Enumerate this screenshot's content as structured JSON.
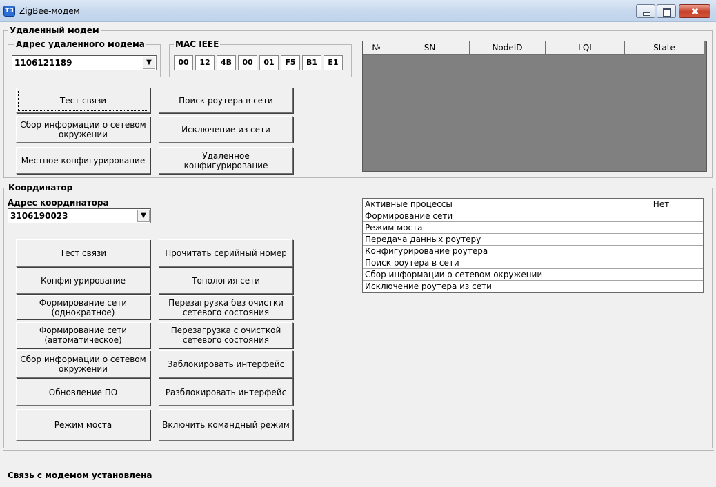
{
  "window": {
    "title": "ZigBee-модем",
    "icon": "tz-app-icon"
  },
  "remote": {
    "group_label": "Удаленный модем",
    "address_label": "Адрес удаленного модема",
    "address_value": "1106121189",
    "mac_label": "MAC IEEE",
    "mac_bytes": [
      "00",
      "12",
      "4B",
      "00",
      "01",
      "F5",
      "B1",
      "E1"
    ],
    "buttons": {
      "test": "Тест связи",
      "find_router": "Поиск роутера в сети",
      "collect_info": "Сбор информации о сетевом окружении",
      "exclude": "Исключение из сети",
      "local_config": "Местное конфигурирование",
      "remote_config": "Удаленное конфигурирование"
    },
    "grid_columns": [
      "№",
      "SN",
      "NodeID",
      "LQI",
      "State"
    ]
  },
  "coordinator": {
    "group_label": "Координатор",
    "address_label": "Адрес координатора",
    "address_value": "3106190023",
    "buttons": {
      "test": "Тест связи",
      "read_serial": "Прочитать серийный номер",
      "configure": "Конфигурирование",
      "topology": "Топология сети",
      "form_once": "Формирование сети (однократное)",
      "reboot_no_clear": "Перезагрузка без очистки сетевого состояния",
      "form_auto": "Формирование сети (автоматическое)",
      "reboot_clear": "Перезагрузка с очисткой сетевого состояния",
      "collect_info": "Сбор информации о сетевом окружении",
      "lock": "Заблокировать интерфейс",
      "update_fw": "Обновление ПО",
      "unlock": "Разблокировать интерфейс",
      "bridge": "Режим моста",
      "command_mode": "Включить командный режим"
    },
    "processes": [
      {
        "name": "Активные процессы",
        "value": "Нет"
      },
      {
        "name": "Формирование сети",
        "value": ""
      },
      {
        "name": "Режим моста",
        "value": ""
      },
      {
        "name": "Передача данных роутеру",
        "value": ""
      },
      {
        "name": "Конфигурирование роутера",
        "value": ""
      },
      {
        "name": "Поиск роутера в сети",
        "value": ""
      },
      {
        "name": "Сбор информации о сетевом окружении",
        "value": ""
      },
      {
        "name": "Исключение роутера из сети",
        "value": ""
      }
    ]
  },
  "status": {
    "message": "Связь с модемом установлена"
  }
}
